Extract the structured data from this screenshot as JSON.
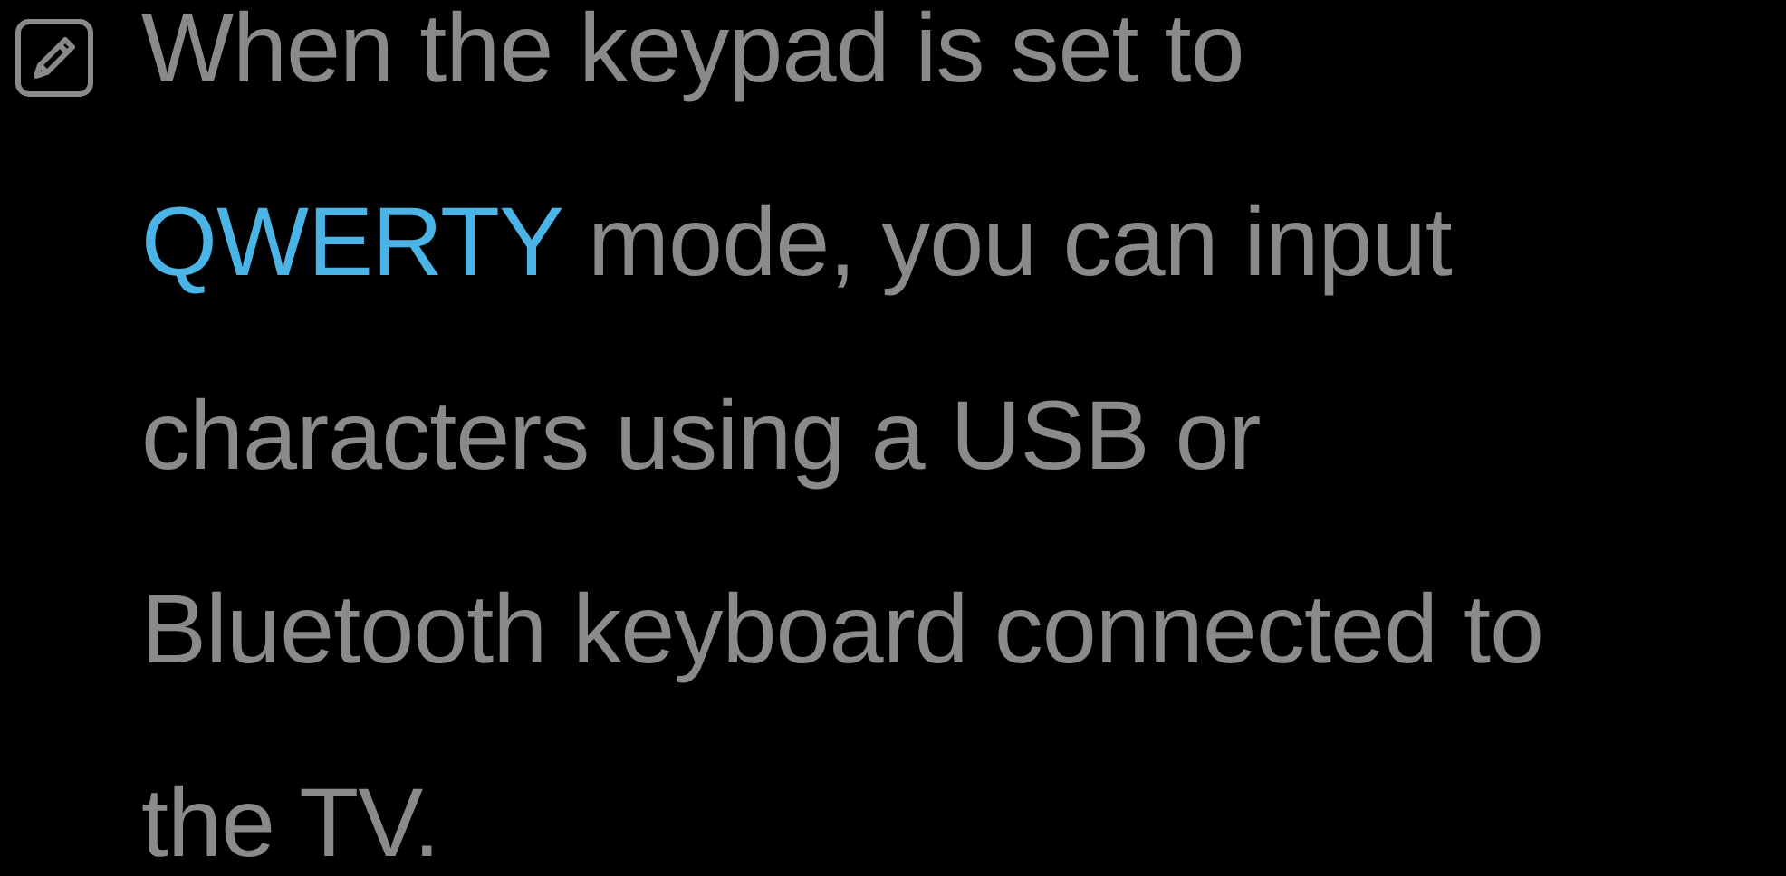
{
  "note": {
    "lines": [
      [
        {
          "text": "When the keypad is set to",
          "highlight": false
        }
      ],
      [
        {
          "text": "QWERTY",
          "highlight": true
        },
        {
          "text": " mode, you can input",
          "highlight": false
        }
      ],
      [
        {
          "text": "characters using a USB or",
          "highlight": false
        }
      ],
      [
        {
          "text": "Bluetooth keyboard connected to",
          "highlight": false
        }
      ],
      [
        {
          "text": "the TV.",
          "highlight": false
        }
      ]
    ]
  }
}
